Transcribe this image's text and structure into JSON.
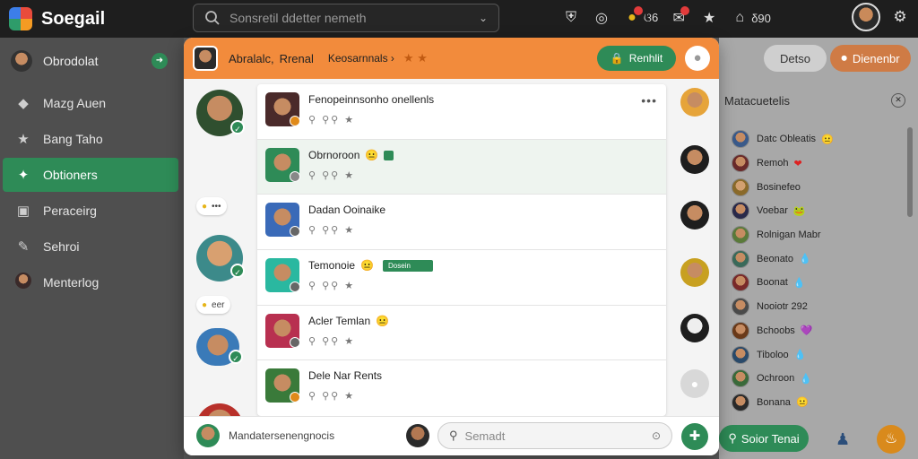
{
  "app": {
    "title": "Soegail"
  },
  "search": {
    "placeholder": "Sonsretil ddetter nemeth"
  },
  "top_icons": [
    {
      "name": "shield-icon",
      "glyph": "⛨"
    },
    {
      "name": "target-icon",
      "glyph": "◎"
    },
    {
      "name": "emoji-icon",
      "glyph": "😀"
    },
    {
      "name": "chat-icon",
      "glyph": "✉"
    },
    {
      "name": "star-icon",
      "glyph": "★"
    },
    {
      "name": "home-icon",
      "glyph": "⌂"
    }
  ],
  "top_counts": {
    "emoji": "ଓ6",
    "home": "δ90"
  },
  "sidebar": {
    "user": "Obrodolat",
    "items": [
      {
        "label": "Mazg Auen",
        "icon": "tag-icon",
        "glyph": "◆"
      },
      {
        "label": "Bang Taho",
        "icon": "star-icon",
        "glyph": "★"
      },
      {
        "label": "Obtioners",
        "icon": "puzzle-icon",
        "glyph": "✦",
        "active": true
      },
      {
        "label": "Peraceirg",
        "icon": "gallery-icon",
        "glyph": "▣"
      },
      {
        "label": "Sehroi",
        "icon": "edit-icon",
        "glyph": "✎"
      },
      {
        "label": "Menterlog",
        "icon": "avatar-icon",
        "glyph": "●"
      }
    ]
  },
  "modal": {
    "header": {
      "name": "Abralalc,",
      "role": "Rrenal",
      "subtitle": "Keosarnnals ›",
      "stars": "★ ★",
      "button_label": "Renhlit"
    },
    "rows": [
      {
        "name": "Fenopeinnsonho onellenls",
        "meta": "⚲ ⚲⚲ ★",
        "emoji": "",
        "tag": "",
        "more": "•••"
      },
      {
        "name": "Obrnoroon",
        "meta": "⚲ ⚲⚲ ★",
        "emoji": "😐",
        "tag": "",
        "more": ""
      },
      {
        "name": "Dadan Ooinaike",
        "meta": "⚲ ⚲⚲ ★",
        "emoji": "",
        "tag": "",
        "more": ""
      },
      {
        "name": "Temonoie",
        "meta": "⚲ ⚲⚲ ★",
        "emoji": "😐",
        "tag": "Dosein",
        "more": ""
      },
      {
        "name": "Acler Temlan",
        "meta": "⚲ ⚲⚲ ★",
        "emoji": "😐",
        "tag": "",
        "more": ""
      },
      {
        "name": "Dele Nar Rents",
        "meta": "⚲ ⚲⚲ ★",
        "emoji": "",
        "tag": "",
        "more": ""
      }
    ],
    "pills": [
      {
        "text": "•••"
      },
      {
        "text": "eer"
      }
    ],
    "footer": {
      "text": "Mandatersenengnocis",
      "search_placeholder": "Semadt"
    }
  },
  "right_panel": {
    "btn_details": "Detso",
    "btn_demand": "Dienenbr",
    "heading": "Matacuetelis",
    "items": [
      {
        "label": "Datc Obleatis",
        "emoji": "😐"
      },
      {
        "label": "Remoh",
        "emoji": "❤"
      },
      {
        "label": "Bosinefeo",
        "emoji": ""
      },
      {
        "label": "Voebar",
        "emoji": "🐸"
      },
      {
        "label": "Rolnigan Mabr",
        "emoji": ""
      },
      {
        "label": "Beonato",
        "emoji": "💧"
      },
      {
        "label": "Boonat",
        "emoji": "💧"
      },
      {
        "label": "Nooiotr 292",
        "emoji": ""
      },
      {
        "label": "Bchoobs",
        "emoji": "💜"
      },
      {
        "label": "Tiboloo",
        "emoji": "💧"
      },
      {
        "label": "Ochroon",
        "emoji": "💧"
      },
      {
        "label": "Bonana",
        "emoji": "😐"
      }
    ],
    "send_label": "Soior Tenai"
  }
}
